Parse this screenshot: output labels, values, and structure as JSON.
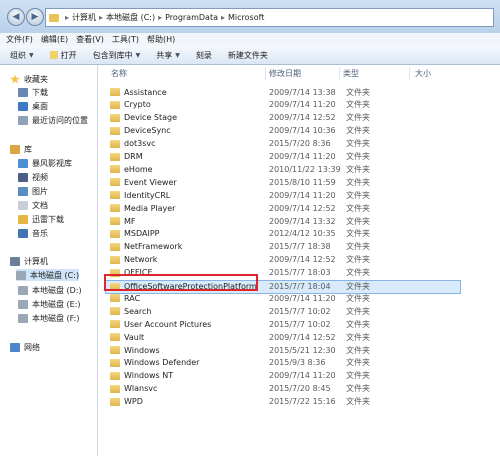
{
  "address": {
    "crumbs": [
      "计算机",
      "本地磁盘 (C:)",
      "ProgramData",
      "Microsoft"
    ]
  },
  "menu": [
    "文件(F)",
    "编辑(E)",
    "查看(V)",
    "工具(T)",
    "帮助(H)"
  ],
  "toolbar": {
    "organize": "组织",
    "open": "打开",
    "include": "包含到库中",
    "share": "共享",
    "burn": "刻录",
    "new_folder": "新建文件夹"
  },
  "nav": {
    "favorites": "收藏夹",
    "downloads": "下载",
    "desktop": "桌面",
    "recent": "最近访问的位置",
    "libraries": "库",
    "storm": "暴风影视库",
    "videos": "视频",
    "pictures": "图片",
    "documents": "文档",
    "xunlei": "迅雷下载",
    "music": "音乐",
    "computer": "计算机",
    "drive_c": "本地磁盘 (C:)",
    "drive_d": "本地磁盘 (D:)",
    "drive_e": "本地磁盘 (E:)",
    "drive_f": "本地磁盘 (F:)",
    "network": "网络"
  },
  "columns": {
    "name": "名称",
    "date": "修改日期",
    "type": "类型",
    "size": "大小"
  },
  "files": [
    {
      "name": "Assistance",
      "date": "2009/7/14 13:38",
      "type": "文件夹"
    },
    {
      "name": "Crypto",
      "date": "2009/7/14 11:20",
      "type": "文件夹"
    },
    {
      "name": "Device Stage",
      "date": "2009/7/14 12:52",
      "type": "文件夹"
    },
    {
      "name": "DeviceSync",
      "date": "2009/7/14 10:36",
      "type": "文件夹"
    },
    {
      "name": "dot3svc",
      "date": "2015/7/20 8:36",
      "type": "文件夹"
    },
    {
      "name": "DRM",
      "date": "2009/7/14 11:20",
      "type": "文件夹"
    },
    {
      "name": "eHome",
      "date": "2010/11/22 13:39",
      "type": "文件夹"
    },
    {
      "name": "Event Viewer",
      "date": "2015/8/10 11:59",
      "type": "文件夹"
    },
    {
      "name": "IdentityCRL",
      "date": "2009/7/14 11:20",
      "type": "文件夹"
    },
    {
      "name": "Media Player",
      "date": "2009/7/14 12:52",
      "type": "文件夹"
    },
    {
      "name": "MF",
      "date": "2009/7/14 13:32",
      "type": "文件夹"
    },
    {
      "name": "MSDAIPP",
      "date": "2012/4/12 10:35",
      "type": "文件夹"
    },
    {
      "name": "NetFramework",
      "date": "2015/7/7 18:38",
      "type": "文件夹"
    },
    {
      "name": "Network",
      "date": "2009/7/14 12:52",
      "type": "文件夹"
    },
    {
      "name": "OFFICE",
      "date": "2015/7/7 18:03",
      "type": "文件夹"
    },
    {
      "name": "OfficeSoftwareProtectionPlatform",
      "date": "2015/7/7 18:04",
      "type": "文件夹"
    },
    {
      "name": "RAC",
      "date": "2009/7/14 11:20",
      "type": "文件夹"
    },
    {
      "name": "Search",
      "date": "2015/7/7 10:02",
      "type": "文件夹"
    },
    {
      "name": "User Account Pictures",
      "date": "2015/7/7 10:02",
      "type": "文件夹"
    },
    {
      "name": "Vault",
      "date": "2009/7/14 12:52",
      "type": "文件夹"
    },
    {
      "name": "Windows",
      "date": "2015/5/21 12:30",
      "type": "文件夹"
    },
    {
      "name": "Windows Defender",
      "date": "2015/9/3 8:36",
      "type": "文件夹"
    },
    {
      "name": "Windows NT",
      "date": "2009/7/14 11:20",
      "type": "文件夹"
    },
    {
      "name": "Wlansvc",
      "date": "2015/7/20 8:45",
      "type": "文件夹"
    },
    {
      "name": "WPD",
      "date": "2015/7/22 15:16",
      "type": "文件夹"
    }
  ]
}
